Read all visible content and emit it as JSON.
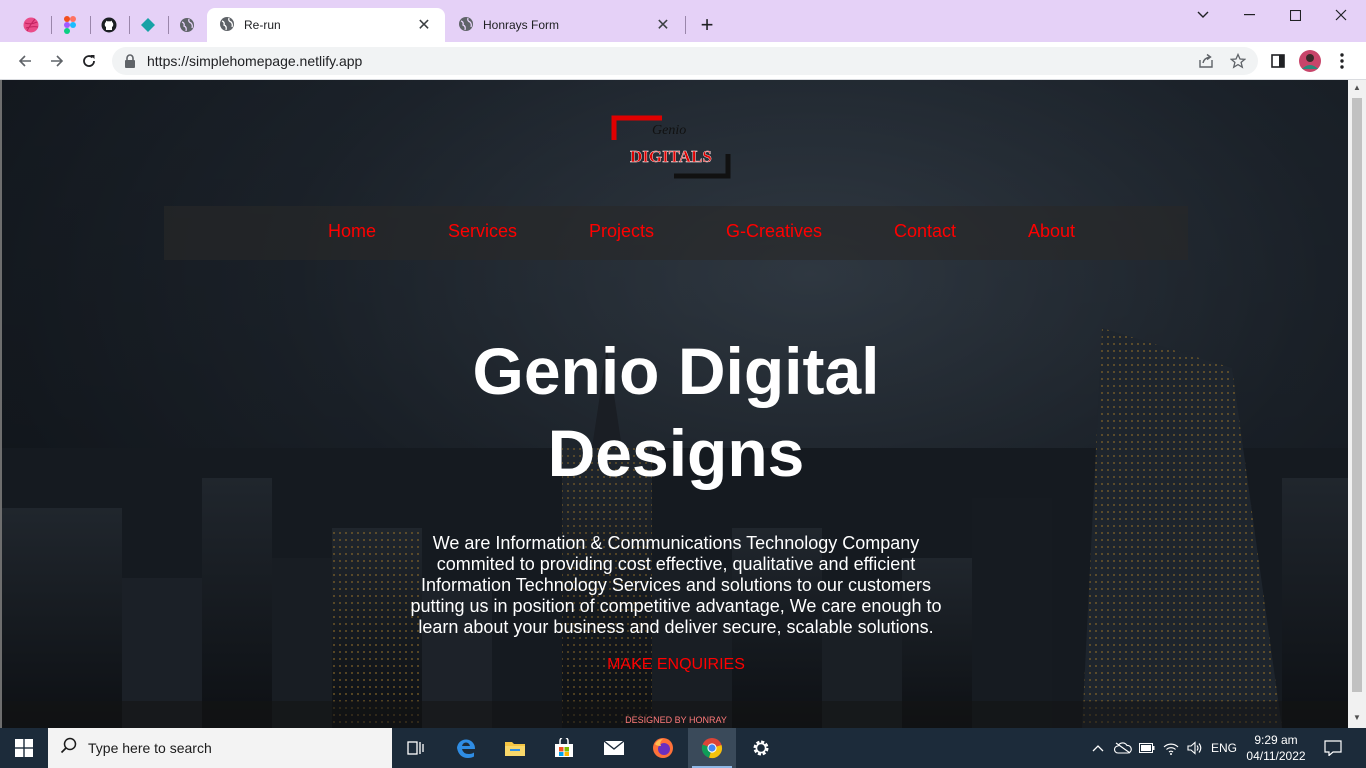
{
  "browser": {
    "tabs": [
      {
        "title": "Re-run",
        "active": true
      },
      {
        "title": "Honrays Form",
        "active": false
      }
    ],
    "pinned_tabs": [
      "dribbble-icon",
      "figma-icon",
      "github-icon",
      "diamond-app-icon",
      "globe-icon"
    ],
    "url": "https://simplehomepage.netlify.app"
  },
  "site": {
    "logo": {
      "small": "Genio",
      "main": "DIGITALS"
    },
    "nav": [
      "Home",
      "Services",
      "Projects",
      "G-Creatives",
      "Contact",
      "About"
    ],
    "headline_line1": "Genio Digital",
    "headline_line2": "Designs",
    "intro": "We are Information & Communications Technology Company commited to providing cost effective, qualitative and efficient Information Technology Services and solutions to our customers putting us in position of competitive advantage, We care enough to learn about your business and deliver secure, scalable solutions.",
    "cta": "MAKE ENQUIRIES",
    "footer": "DESIGNED BY HONRAY",
    "accent": "#ff0000"
  },
  "taskbar": {
    "search_placeholder": "Type here to search",
    "language": "ENG",
    "time": "9:29 am",
    "date": "04/11/2022"
  }
}
